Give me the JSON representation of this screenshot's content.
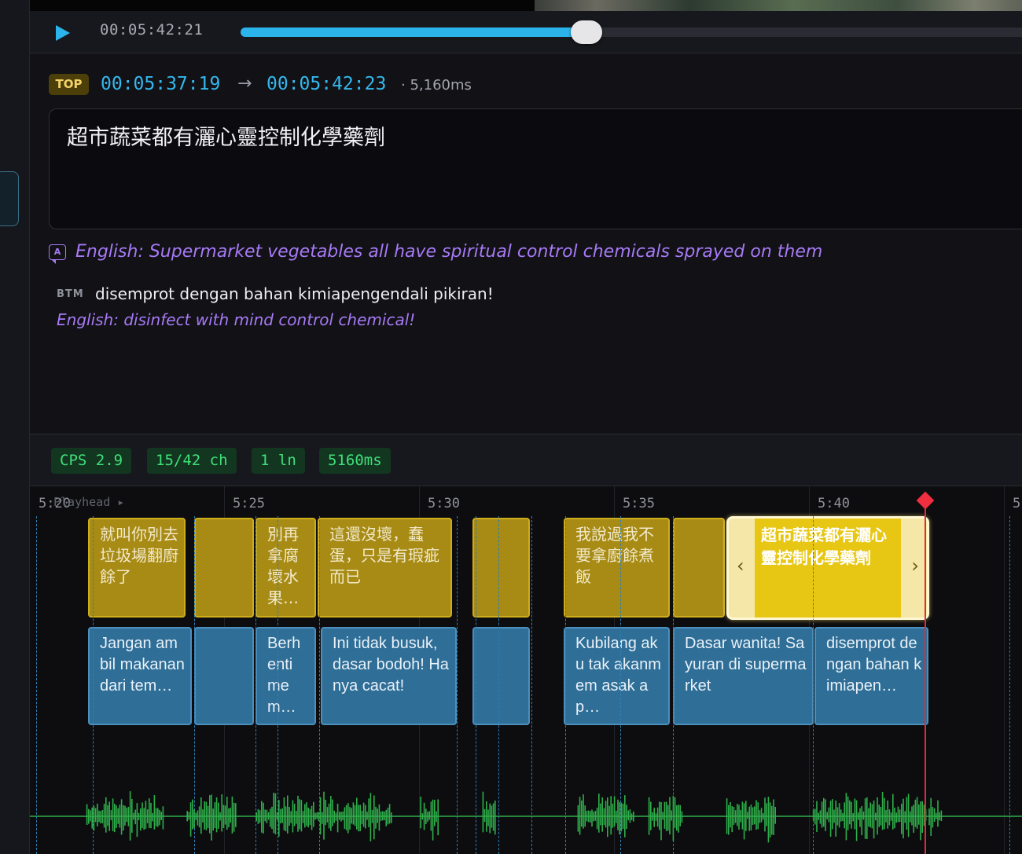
{
  "transport": {
    "timecode": "00:05:42:21",
    "progress_fraction": 0.44
  },
  "editor": {
    "track_badge": "TOP",
    "start_time": "00:05:37:19",
    "arrow": "→",
    "end_time": "00:05:42:23",
    "duration": "· 5,160ms",
    "text": "超市蔬菜都有灑心靈控制化學藥劑",
    "translation": "English: Supermarket vegetables all have spiritual control chemicals sprayed on them",
    "btm": {
      "badge": "BTM",
      "text": "disemprot dengan bahan kimiapengendali pikiran!",
      "translation": "English: disinfect with mind control chemical!"
    }
  },
  "stats": {
    "cps": "CPS 2.9",
    "chars": "15/42 ch",
    "lines": "1 ln",
    "duration": "5160ms"
  },
  "timeline": {
    "playhead_label": "Playhead ▸",
    "ticks": [
      "5:20",
      "5:25",
      "5:30",
      "5:35",
      "5:40",
      "5"
    ],
    "top_clips": [
      {
        "text": "就叫你別去垃圾場翻廚餘了"
      },
      {
        "text": ""
      },
      {
        "text": "別再拿腐壞水果…"
      },
      {
        "text": "這還沒壞，蠢蛋，只是有瑕疵而已"
      },
      {
        "text": ""
      },
      {
        "text": "我說過我不要拿廚餘煮飯"
      },
      {
        "text": ""
      }
    ],
    "active_clip": {
      "text": "超市蔬菜都有灑心靈控制化學藥劑",
      "handle_left": "‹",
      "handle_right": "›"
    },
    "btm_clips": [
      {
        "text": "Jangan ambil makanan dari tem…"
      },
      {
        "text": ""
      },
      {
        "text": "Berh enti me m…"
      },
      {
        "text": "Ini tidak busuk, dasar bodoh! Hanya cacat!"
      },
      {
        "text": ""
      },
      {
        "text": "Kubilang aku tak akanmem asak ap…"
      },
      {
        "text": "Dasar wanita! Sayuran di supermarket"
      },
      {
        "text": "disemprot dengan bahan kimiapen…"
      }
    ]
  },
  "colors": {
    "accent": "#2bb3ec",
    "top_clip": "#a78b14",
    "btm_clip": "#2f6e97",
    "active_clip": "#e7c713",
    "playhead": "#e3293a",
    "waveform": "#2fae4a",
    "translation": "#a77af5"
  }
}
